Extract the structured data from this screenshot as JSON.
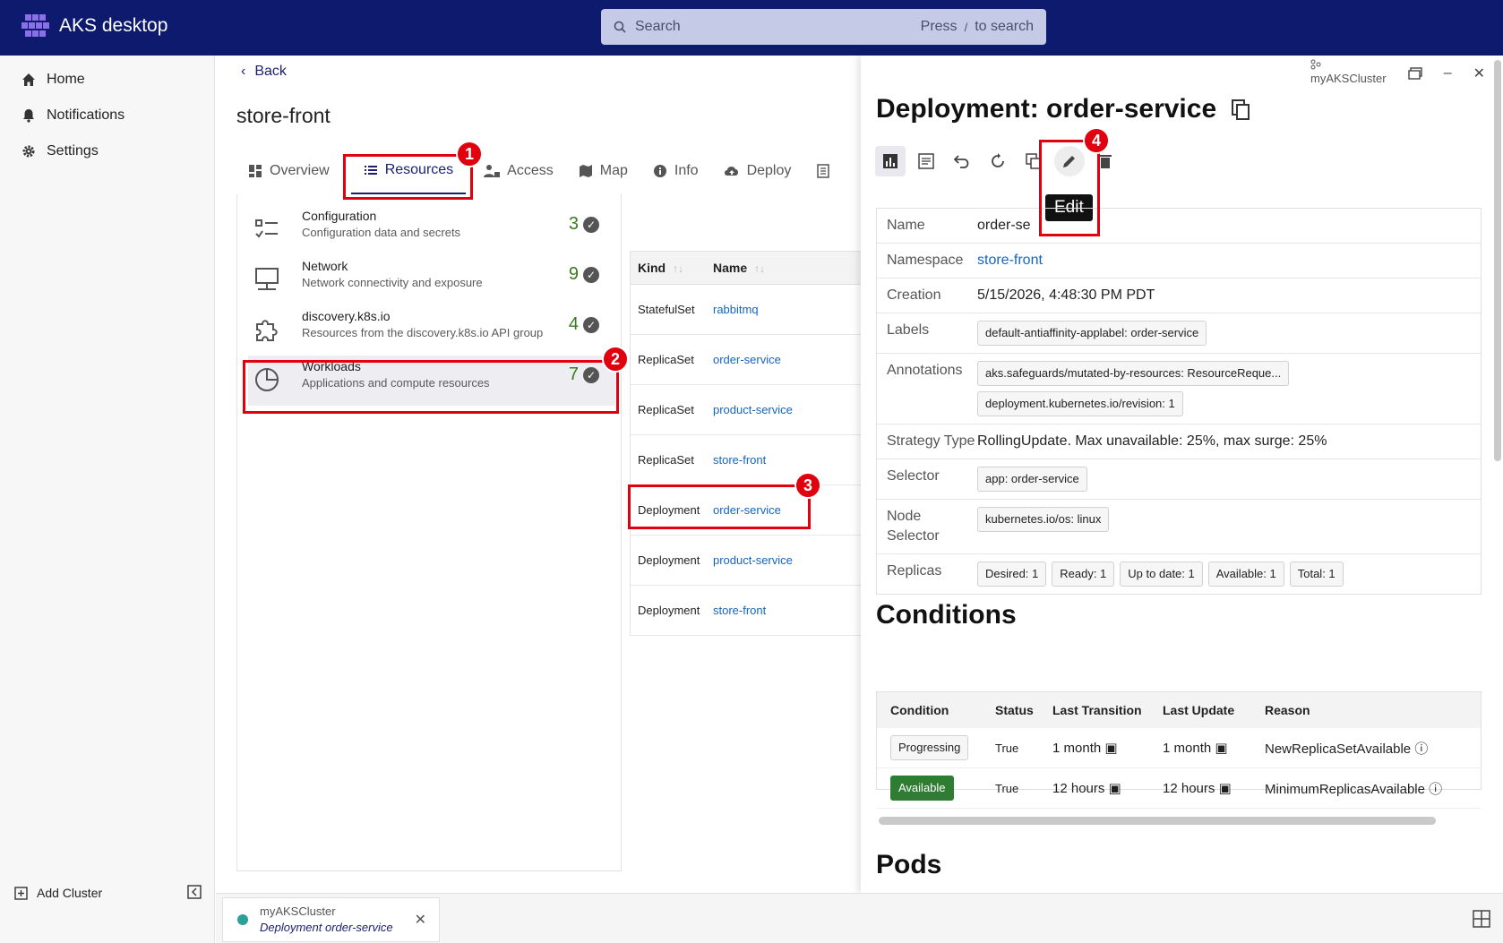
{
  "app": {
    "title": "AKS desktop"
  },
  "search": {
    "placeholder": "Search",
    "hint_press": "Press",
    "hint_key": "/",
    "hint_rest": "to search"
  },
  "sidebar": {
    "items": [
      {
        "label": "Home",
        "icon": "home-icon"
      },
      {
        "label": "Notifications",
        "icon": "bell-icon"
      },
      {
        "label": "Settings",
        "icon": "gear-icon"
      }
    ],
    "add_cluster": "Add Cluster"
  },
  "main": {
    "back": "Back",
    "title": "store-front",
    "tabs": [
      {
        "label": "Overview"
      },
      {
        "label": "Resources",
        "active": true
      },
      {
        "label": "Access"
      },
      {
        "label": "Map"
      },
      {
        "label": "Info"
      },
      {
        "label": "Deploy"
      }
    ],
    "resources": [
      {
        "title": "Configuration",
        "desc": "Configuration data and secrets",
        "count": "3"
      },
      {
        "title": "Network",
        "desc": "Network connectivity and exposure",
        "count": "9"
      },
      {
        "title": "discovery.k8s.io",
        "desc": "Resources from the discovery.k8s.io API group",
        "count": "4"
      },
      {
        "title": "Workloads",
        "desc": "Applications and compute resources",
        "count": "7"
      }
    ],
    "table": {
      "headers": [
        "Kind",
        "Name"
      ],
      "rows": [
        {
          "kind": "StatefulSet",
          "name": "rabbitmq"
        },
        {
          "kind": "ReplicaSet",
          "name": "order-service"
        },
        {
          "kind": "ReplicaSet",
          "name": "product-service"
        },
        {
          "kind": "ReplicaSet",
          "name": "store-front"
        },
        {
          "kind": "Deployment",
          "name": "order-service"
        },
        {
          "kind": "Deployment",
          "name": "product-service"
        },
        {
          "kind": "Deployment",
          "name": "store-front"
        }
      ]
    }
  },
  "drawer": {
    "cluster": "myAKSCluster",
    "title": "Deployment: order-service",
    "tooltip": "Edit",
    "metadata": {
      "name_label": "Name",
      "name_value": "order-se",
      "namespace_label": "Namespace",
      "namespace_value": "store-front",
      "creation_label": "Creation",
      "creation_value": "5/15/2026, 4:48:30 PM PDT",
      "labels_label": "Labels",
      "labels": [
        "default-antiaffinity-applabel: order-service"
      ],
      "annotations_label": "Annotations",
      "annotations": [
        "aks.safeguards/mutated-by-resources: ResourceReque...",
        "deployment.kubernetes.io/revision: 1"
      ],
      "strategy_label": "Strategy Type",
      "strategy_value": "RollingUpdate. Max unavailable: 25%, max surge: 25%",
      "selector_label": "Selector",
      "selector": [
        "app: order-service"
      ],
      "node_selector_label": "Node Selector",
      "node_selector": [
        "kubernetes.io/os: linux"
      ],
      "replicas_label": "Replicas",
      "replicas": [
        "Desired: 1",
        "Ready: 1",
        "Up to date: 1",
        "Available: 1",
        "Total: 1"
      ]
    },
    "conditions_heading": "Conditions",
    "conditions": {
      "headers": [
        "Condition",
        "Status",
        "Last Transition",
        "Last Update",
        "Reason"
      ],
      "rows": [
        {
          "condition": "Progressing",
          "status": "True",
          "transition": "1 month",
          "update": "1 month",
          "reason": "NewReplicaSetAvailable"
        },
        {
          "condition": "Available",
          "status": "True",
          "transition": "12 hours",
          "update": "12 hours",
          "reason": "MinimumReplicasAvailable"
        }
      ]
    },
    "pods_heading": "Pods"
  },
  "bottom": {
    "tab_cluster": "myAKSCluster",
    "tab_label": "Deployment order-service"
  },
  "annotations_markers": [
    "1",
    "2",
    "3",
    "4"
  ],
  "colors": {
    "topbar": "#0e1a6e",
    "accent": "#1b1f6e",
    "highlight": "#e0000e",
    "link": "#1565c0",
    "count": "#3b7a1f"
  }
}
